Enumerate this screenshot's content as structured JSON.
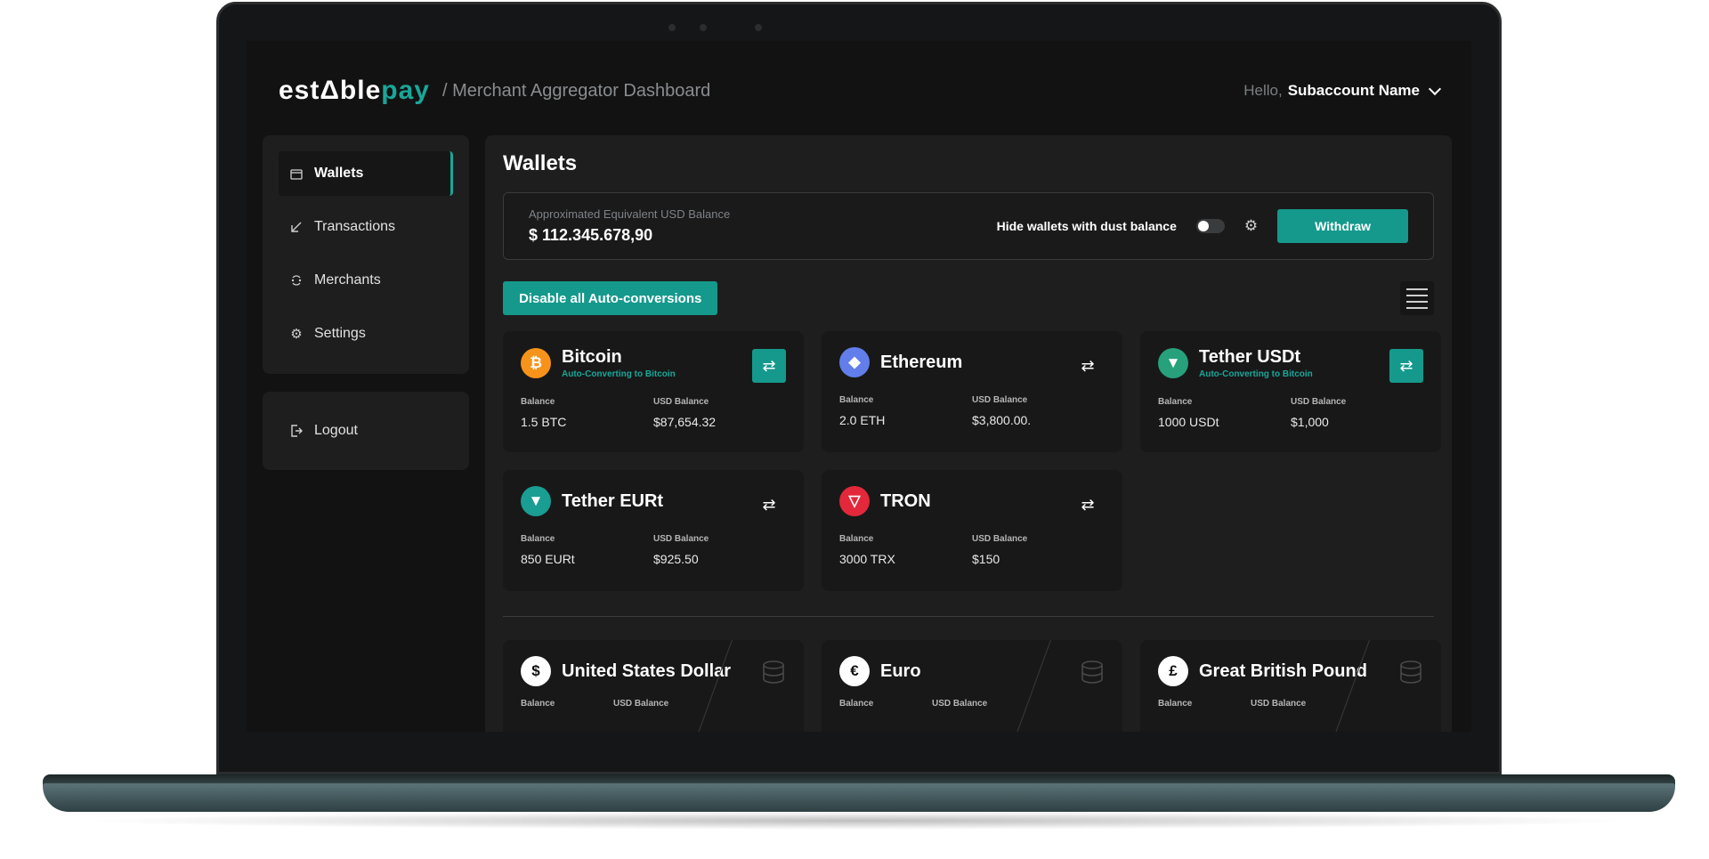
{
  "header": {
    "logo_main": "estΔble",
    "logo_accent": "pay",
    "breadcrumb": "/ Merchant Aggregator Dashboard",
    "greeting": "Hello,",
    "user_name": "Subaccount Name"
  },
  "sidebar": {
    "items": [
      {
        "label": "Wallets",
        "icon": "wallet-icon",
        "active": true
      },
      {
        "label": "Transactions",
        "icon": "arrow-down-left-icon",
        "active": false
      },
      {
        "label": "Merchants",
        "icon": "merchants-icon",
        "active": false
      },
      {
        "label": "Settings",
        "icon": "gear-icon",
        "active": false
      }
    ],
    "logout_label": "Logout"
  },
  "main": {
    "title": "Wallets",
    "balance_label": "Approximated Equivalent USD Balance",
    "balance_value": "$ 112.345.678,90",
    "dust_label": "Hide wallets with dust balance",
    "withdraw_label": "Withdraw",
    "disable_label": "Disable all Auto-conversions"
  },
  "crypto_wallets": [
    {
      "name": "Bitcoin",
      "symbol": "₿",
      "color": "#f7931a",
      "sub": "Auto-Converting to Bitcoin",
      "auto": true,
      "balance_label": "Balance",
      "balance": "1.5 BTC",
      "usd_label": "USD Balance",
      "usd": "$87,654.32"
    },
    {
      "name": "Ethereum",
      "symbol": "◆",
      "color": "#627eea",
      "sub": "",
      "auto": false,
      "balance_label": "Balance",
      "balance": "2.0 ETH",
      "usd_label": "USD Balance",
      "usd": "$3,800.00."
    },
    {
      "name": "Tether USDt",
      "symbol": "▼",
      "color": "#26a17b",
      "sub": "Auto-Converting to Bitcoin",
      "auto": true,
      "balance_label": "Balance",
      "balance": "1000 USDt",
      "usd_label": "USD Balance",
      "usd": "$1,000"
    },
    {
      "name": "Tether EURt",
      "symbol": "▼",
      "color": "#1a9d92",
      "sub": "",
      "auto": false,
      "balance_label": "Balance",
      "balance": "850 EURt",
      "usd_label": "USD Balance",
      "usd": "$925.50"
    },
    {
      "name": "TRON",
      "symbol": "▽",
      "color": "#e2283a",
      "sub": "",
      "auto": false,
      "balance_label": "Balance",
      "balance": "3000 TRX",
      "usd_label": "USD Balance",
      "usd": "$150"
    }
  ],
  "fiat_wallets": [
    {
      "name": "United States Dollar",
      "symbol": "$",
      "balance_label": "Balance",
      "usd_label": "USD Balance"
    },
    {
      "name": "Euro",
      "symbol": "€",
      "balance_label": "Balance",
      "usd_label": "USD Balance"
    },
    {
      "name": "Great British Pound",
      "symbol": "£",
      "balance_label": "Balance",
      "usd_label": "USD Balance"
    }
  ],
  "colors": {
    "accent": "#15998c",
    "background": "#121212",
    "panel": "#1e1e1e"
  }
}
